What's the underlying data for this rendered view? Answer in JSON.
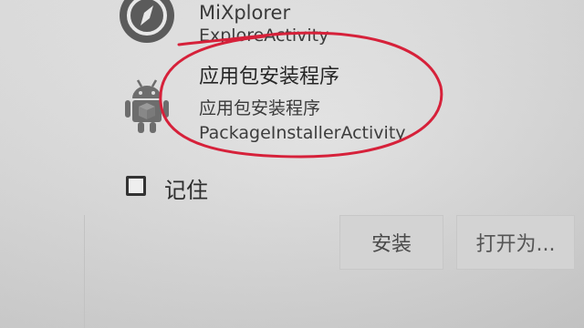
{
  "apps": [
    {
      "name": "MiXplorer",
      "activity": "ExploreActivity",
      "icon": "compass-icon"
    },
    {
      "title": "应用包安装程序",
      "name": "应用包安装程序",
      "activity": "PackageInstallerActivity",
      "icon": "android-icon"
    }
  ],
  "remember": {
    "label": "记住",
    "checked": false
  },
  "buttons": {
    "install": "安装",
    "open_with": "打开为..."
  },
  "colors": {
    "annotation": "#d6213a",
    "button_bg": "#d3d3d3"
  }
}
